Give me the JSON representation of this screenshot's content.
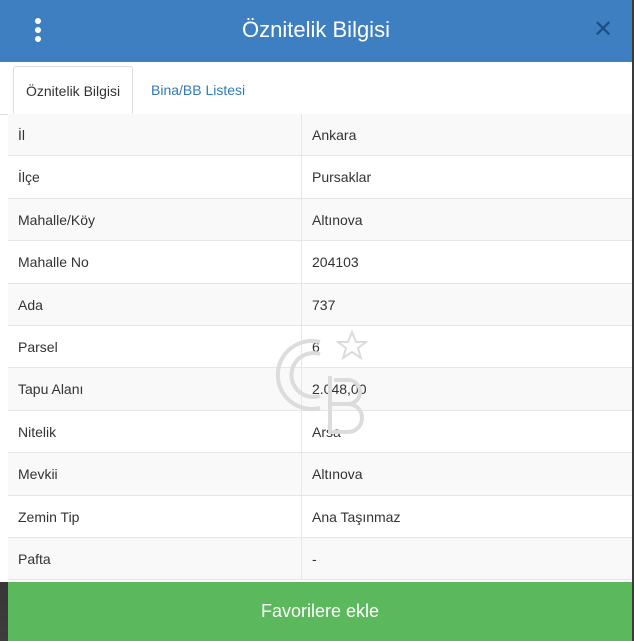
{
  "modal": {
    "title": "Öznitelik Bilgisi",
    "menu_icon": "vertical-dots-icon",
    "close_icon": "close-icon"
  },
  "tabs": [
    {
      "label": "Öznitelik Bilgisi",
      "active": true
    },
    {
      "label": "Bina/BB Listesi",
      "active": false
    }
  ],
  "attributes": [
    {
      "key": "İl",
      "value": "Ankara"
    },
    {
      "key": "İlçe",
      "value": "Pursaklar"
    },
    {
      "key": "Mahalle/Köy",
      "value": "Altınova"
    },
    {
      "key": "Mahalle No",
      "value": "204103"
    },
    {
      "key": "Ada",
      "value": "737"
    },
    {
      "key": "Parsel",
      "value": "6"
    },
    {
      "key": "Tapu Alanı",
      "value": "2.048,00"
    },
    {
      "key": "Nitelik",
      "value": "Arsa"
    },
    {
      "key": "Mevkii",
      "value": "Altınova"
    },
    {
      "key": "Zemin Tip",
      "value": "Ana Taşınmaz"
    },
    {
      "key": "Pafta",
      "value": "-"
    }
  ],
  "footer": {
    "button_label": "Favorilere ekle"
  },
  "colors": {
    "header": "#3d7fc0",
    "footer": "#5cb85c",
    "link": "#337ab7"
  }
}
